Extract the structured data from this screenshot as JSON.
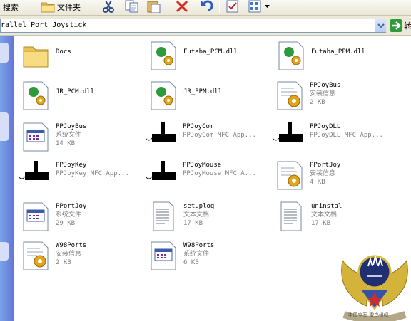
{
  "toolbar": {
    "search_label": "搜索",
    "folders_label": "文件夹"
  },
  "address": {
    "path": "rallel Port Joystick",
    "go_label": "转"
  },
  "files": [
    {
      "name": "Docs",
      "type": "folder"
    },
    {
      "name": "Futaba_PCM.dll",
      "type": "dll"
    },
    {
      "name": "Futaba_PPM.dll",
      "type": "dll"
    },
    {
      "name": "JR_PCM.dll",
      "type": "dll"
    },
    {
      "name": "JR_PPM.dll",
      "type": "dll"
    },
    {
      "name": "PPJoyBus",
      "desc": "安装信息",
      "size": "2 KB",
      "type": "inf"
    },
    {
      "name": "PPJoyBus",
      "desc": "系统文件",
      "size": "14 KB",
      "type": "sys"
    },
    {
      "name": "PPJoyCom",
      "desc": "PPJoyCom MFC App...",
      "type": "joystick"
    },
    {
      "name": "PPJoyDLL",
      "desc": "PPJoyDLL MFC App...",
      "type": "joystick"
    },
    {
      "name": "PPJoyKey",
      "desc": "PPJoyKey MFC App...",
      "type": "joystick"
    },
    {
      "name": "PPJoyMouse",
      "desc": "PPJoyMouse MFC A...",
      "type": "joystick"
    },
    {
      "name": "PPortJoy",
      "desc": "安装信息",
      "size": "4 KB",
      "type": "inf"
    },
    {
      "name": "PPortJoy",
      "desc": "系统文件",
      "size": "29 KB",
      "type": "sys"
    },
    {
      "name": "setuplog",
      "desc": "文本文档",
      "size": "17 KB",
      "type": "txt"
    },
    {
      "name": "uninstal",
      "desc": "文本文档",
      "size": "17 KB",
      "type": "txt"
    },
    {
      "name": "W98Ports",
      "desc": "安装信息",
      "size": "2 KB",
      "type": "inf"
    },
    {
      "name": "W98Ports",
      "desc": "系统文件",
      "size": "6 KB",
      "type": "sys"
    }
  ],
  "watermark": {
    "text": "中国空军 雷鸟组织"
  },
  "colors": {
    "toolbar_bg": "#ece9d8",
    "taskpane": "#6d8ee0",
    "meta_text": "#808080"
  }
}
